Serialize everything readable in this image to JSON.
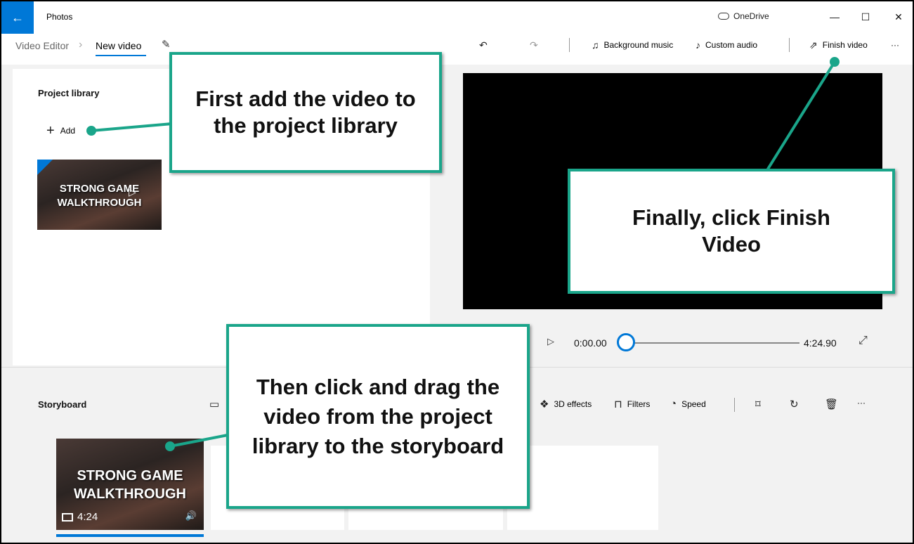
{
  "titlebar": {
    "app_name": "Photos",
    "onedrive_label": "OneDrive",
    "minimize": "—",
    "maximize": "☐",
    "close": "✕",
    "back_arrow": "←"
  },
  "breadcrumb": {
    "parent": "Video Editor",
    "separator": "›",
    "current": "New video"
  },
  "toolbar": {
    "undo": "↶",
    "redo": "↷",
    "background_music": "Background music",
    "custom_audio": "Custom audio",
    "finish_video": "Finish video",
    "more": "···"
  },
  "project_library": {
    "title": "Project library",
    "add_label": "Add",
    "thumbnail_text_line1": "STRONG GAME",
    "thumbnail_text_line2": "WALKTHROUGH"
  },
  "player": {
    "time_start": "0:00.00",
    "time_end": "4:24.90"
  },
  "storyboard": {
    "title": "Storyboard",
    "tools": {
      "effects_3d": "3D effects",
      "filters": "Filters",
      "speed": "Speed",
      "more": "···"
    },
    "clip": {
      "text_line1": "STRONG GAME",
      "text_line2": "WALKTHROUGH",
      "duration": "4:24"
    }
  },
  "callouts": {
    "add_to_library": "First add the video to the project library",
    "finish": "Finally, click Finish Video",
    "drag": "Then click and drag the video from the project library to the storyboard"
  },
  "colors": {
    "accent": "#0078d7",
    "callout_border": "#1aa58a"
  },
  "icons": {
    "back": "back-arrow-icon",
    "onedrive": "cloud-icon",
    "edit": "pencil-icon",
    "music": "music-note-icon",
    "custom_audio": "custom-audio-icon",
    "finish": "share-export-icon",
    "add": "plus-icon",
    "play": "play-icon",
    "expand": "expand-icon",
    "effects_3d": "3d-effects-icon",
    "filters": "filters-icon",
    "speed": "speed-icon",
    "crop": "crop-icon",
    "rotate": "rotate-icon",
    "delete": "trash-icon",
    "duration": "film-icon",
    "volume": "volume-icon"
  }
}
